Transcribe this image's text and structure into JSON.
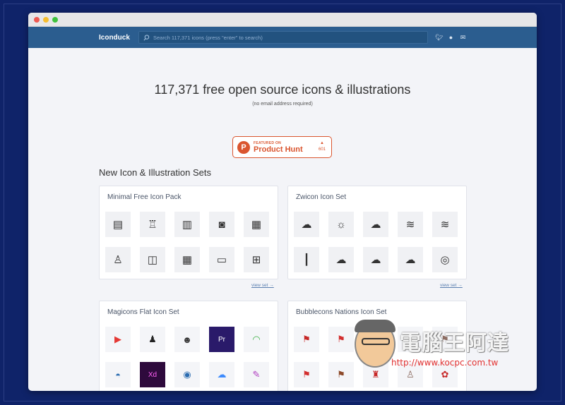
{
  "navbar": {
    "brand": "Iconduck",
    "search_placeholder": "Search 117,371 icons (press \"enter\" to search)",
    "social": [
      "twitter-icon",
      "github-icon",
      "mail-icon"
    ]
  },
  "hero": {
    "title": "117,371 free open source icons & illustrations",
    "subtitle": "(no email address required)"
  },
  "product_hunt": {
    "logo": "P",
    "featured": "FEATURED ON",
    "name": "Product Hunt",
    "arrow": "▲",
    "votes": "601"
  },
  "section_title": "New Icon & Illustration Sets",
  "sets": [
    {
      "title": "Minimal Free Icon Pack",
      "view": "view set →",
      "icons": [
        "▤",
        "♖",
        "▥",
        "◙",
        "▦",
        "♙",
        "◫",
        "▦",
        "▭",
        "⊞"
      ]
    },
    {
      "title": "Zwicon Icon Set",
      "view": "view set →",
      "icons": [
        "☁",
        "☼",
        "☁",
        "≋",
        "≋",
        "┃",
        "☁",
        "☁",
        "☁",
        "◎"
      ]
    },
    {
      "title": "Magicons Flat Icon Set",
      "icons": [
        "▶",
        "♟",
        "☻",
        "Pr",
        "◠",
        "◓",
        "Xd",
        "◉",
        "☁",
        "✎"
      ]
    },
    {
      "title": "Bubblecons Nations Icon Set",
      "icons": [
        "⚑",
        "⚑",
        "⚑",
        "⚑",
        "⚑",
        "⚑",
        "⚑",
        "♜",
        "♙",
        "✿"
      ]
    }
  ],
  "watermark": {
    "title": "電腦王阿達",
    "url": "http://www.kocpc.com.tw"
  },
  "colors": {
    "navbar": "#2b5d8f",
    "background": "#0f2369",
    "product_hunt": "#da552f"
  }
}
